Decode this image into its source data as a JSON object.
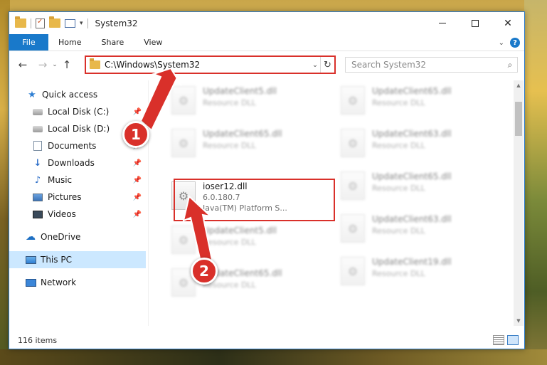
{
  "window": {
    "title": "System32",
    "minimize_glyph": "",
    "maximize_glyph": "",
    "close_glyph": "✕"
  },
  "ribbon": {
    "tabs": [
      "File",
      "Home",
      "Share",
      "View"
    ],
    "help_glyph": "?"
  },
  "navbar": {
    "address_path": "C:\\Windows\\System32",
    "search_placeholder": "Search System32"
  },
  "sidebar": {
    "items": [
      {
        "label": "Quick access",
        "icon": "star-icon",
        "pinned": false
      },
      {
        "label": "Local Disk (C:)",
        "icon": "disk-icon",
        "pinned": true
      },
      {
        "label": "Local Disk (D:)",
        "icon": "disk-icon",
        "pinned": false
      },
      {
        "label": "Documents",
        "icon": "documents-icon",
        "pinned": true
      },
      {
        "label": "Downloads",
        "icon": "download-icon",
        "pinned": true
      },
      {
        "label": "Music",
        "icon": "music-icon",
        "pinned": true
      },
      {
        "label": "Pictures",
        "icon": "pictures-icon",
        "pinned": true
      },
      {
        "label": "Videos",
        "icon": "videos-icon",
        "pinned": true
      },
      {
        "label": "OneDrive",
        "icon": "onedrive-icon",
        "pinned": false
      },
      {
        "label": "This PC",
        "icon": "pc-icon",
        "pinned": false,
        "selected": true
      },
      {
        "label": "Network",
        "icon": "network-icon",
        "pinned": false
      }
    ]
  },
  "files": {
    "left": [
      {
        "name": "UpdateClient5.dll",
        "desc": "Resource DLL"
      },
      {
        "name": "UpdateClient65.dll",
        "desc": "Resource DLL"
      },
      {
        "name": "ioser12.dll",
        "version": "6.0.180.7",
        "desc": "Java(TM) Platform S..."
      },
      {
        "name": "UpdateClient5.dll",
        "desc": "Resource DLL"
      },
      {
        "name": "UpdateClient65.dll",
        "desc": "Resource DLL"
      }
    ],
    "right": [
      {
        "name": "UpdateClient65.dll",
        "desc": "Resource DLL"
      },
      {
        "name": "UpdateClient63.dll",
        "desc": "Resource DLL"
      },
      {
        "name": "UpdateClient65.dll",
        "desc": "Resource DLL"
      },
      {
        "name": "UpdateClient63.dll",
        "desc": "Resource DLL"
      },
      {
        "name": "UpdateClient19.dll",
        "desc": "Resource DLL"
      }
    ]
  },
  "status": {
    "item_count": "116 items"
  },
  "annotations": {
    "step1": "1",
    "step2": "2",
    "accent_color": "#d9302a"
  },
  "colors": {
    "file_tab": "#1979ca",
    "selected_nav": "#cce8ff"
  }
}
